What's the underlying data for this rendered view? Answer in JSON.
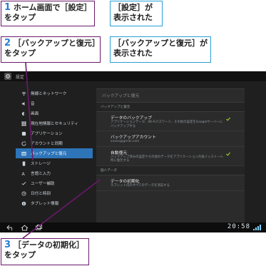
{
  "callouts": {
    "step1_num": "1",
    "step1_text": "ホーム画面で［設定］をタップ",
    "result1_text": "［設定］が表示された",
    "step2_num": "2",
    "step2_text": "［バックアップと復元］をタップ",
    "result2_text": "［バックアップと復元］が表示された",
    "step3_num": "3",
    "step3_text": "［データの初期化］をタップ"
  },
  "statusbar": {
    "title": "設定"
  },
  "sidebar": {
    "items": [
      {
        "label": "無線とネットワーク",
        "icon": "wifi-icon"
      },
      {
        "label": "音",
        "icon": "speaker-icon"
      },
      {
        "label": "画面",
        "icon": "brightness-icon"
      },
      {
        "label": "現在地情報とセキュリティ",
        "icon": "grid-icon"
      },
      {
        "label": "アプリケーション",
        "icon": "apps-icon"
      },
      {
        "label": "アカウントと同期",
        "icon": "sync-icon"
      },
      {
        "label": "バックアップと復元",
        "icon": "backup-icon",
        "active": true
      },
      {
        "label": "ストレージ",
        "icon": "storage-icon"
      },
      {
        "label": "言語と入力",
        "icon": "keyboard-icon"
      },
      {
        "label": "ユーザー補助",
        "icon": "accessibility-icon"
      },
      {
        "label": "日付と時刻",
        "icon": "clock-icon"
      },
      {
        "label": "タブレット情報",
        "icon": "info-icon"
      }
    ]
  },
  "panel": {
    "title": "バックアップと復元",
    "sections": [
      {
        "header": "バックアップと復元",
        "rows": [
          {
            "title": "データのバックアップ",
            "subtitle": "アプリケーションデータ、Wi-Fiパスワード、その他の設定をGoogleサーバーにバックアップする",
            "checked": true
          },
          {
            "title": "バックアップアカウント",
            "subtitle": "xxxxx@gmail.com",
            "checked": false
          },
          {
            "title": "自動復元",
            "subtitle": "バックアップ済みの設定やその他のデータをアプリケーションの再インストール時に復元する",
            "checked": true
          }
        ]
      },
      {
        "header": "個人データ",
        "rows": [
          {
            "title": "データの初期化",
            "subtitle": "タブレット内のすべてのデータを消去する",
            "checked": false
          }
        ]
      }
    ]
  },
  "navbar": {
    "time": "20:58"
  },
  "colors": {
    "accent": "#2d74b8",
    "step_border": "#6a1a6a",
    "result_border": "#2a9fd6",
    "check": "#9acd32"
  }
}
